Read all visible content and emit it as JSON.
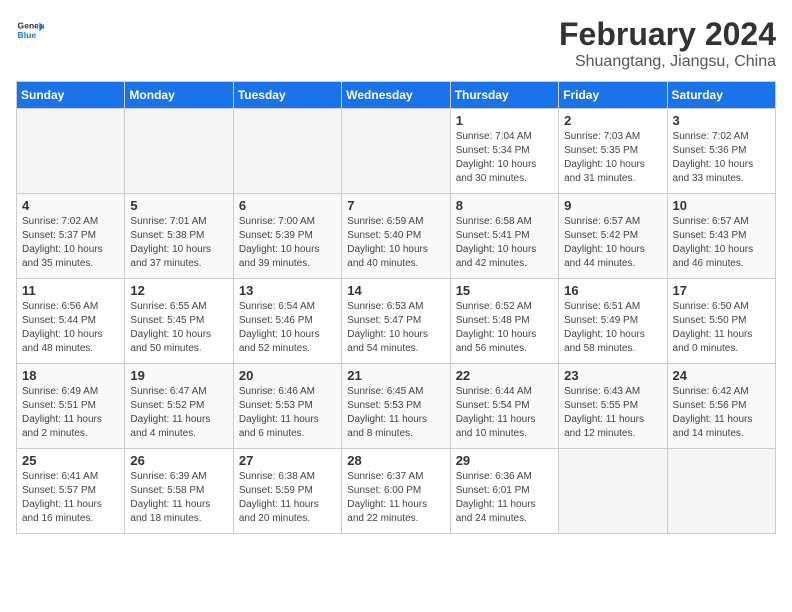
{
  "header": {
    "logo_general": "General",
    "logo_blue": "Blue",
    "month_year": "February 2024",
    "location": "Shuangtang, Jiangsu, China"
  },
  "days_of_week": [
    "Sunday",
    "Monday",
    "Tuesday",
    "Wednesday",
    "Thursday",
    "Friday",
    "Saturday"
  ],
  "weeks": [
    [
      {
        "num": "",
        "text": ""
      },
      {
        "num": "",
        "text": ""
      },
      {
        "num": "",
        "text": ""
      },
      {
        "num": "",
        "text": ""
      },
      {
        "num": "1",
        "text": "Sunrise: 7:04 AM\nSunset: 5:34 PM\nDaylight: 10 hours\nand 30 minutes."
      },
      {
        "num": "2",
        "text": "Sunrise: 7:03 AM\nSunset: 5:35 PM\nDaylight: 10 hours\nand 31 minutes."
      },
      {
        "num": "3",
        "text": "Sunrise: 7:02 AM\nSunset: 5:36 PM\nDaylight: 10 hours\nand 33 minutes."
      }
    ],
    [
      {
        "num": "4",
        "text": "Sunrise: 7:02 AM\nSunset: 5:37 PM\nDaylight: 10 hours\nand 35 minutes."
      },
      {
        "num": "5",
        "text": "Sunrise: 7:01 AM\nSunset: 5:38 PM\nDaylight: 10 hours\nand 37 minutes."
      },
      {
        "num": "6",
        "text": "Sunrise: 7:00 AM\nSunset: 5:39 PM\nDaylight: 10 hours\nand 39 minutes."
      },
      {
        "num": "7",
        "text": "Sunrise: 6:59 AM\nSunset: 5:40 PM\nDaylight: 10 hours\nand 40 minutes."
      },
      {
        "num": "8",
        "text": "Sunrise: 6:58 AM\nSunset: 5:41 PM\nDaylight: 10 hours\nand 42 minutes."
      },
      {
        "num": "9",
        "text": "Sunrise: 6:57 AM\nSunset: 5:42 PM\nDaylight: 10 hours\nand 44 minutes."
      },
      {
        "num": "10",
        "text": "Sunrise: 6:57 AM\nSunset: 5:43 PM\nDaylight: 10 hours\nand 46 minutes."
      }
    ],
    [
      {
        "num": "11",
        "text": "Sunrise: 6:56 AM\nSunset: 5:44 PM\nDaylight: 10 hours\nand 48 minutes."
      },
      {
        "num": "12",
        "text": "Sunrise: 6:55 AM\nSunset: 5:45 PM\nDaylight: 10 hours\nand 50 minutes."
      },
      {
        "num": "13",
        "text": "Sunrise: 6:54 AM\nSunset: 5:46 PM\nDaylight: 10 hours\nand 52 minutes."
      },
      {
        "num": "14",
        "text": "Sunrise: 6:53 AM\nSunset: 5:47 PM\nDaylight: 10 hours\nand 54 minutes."
      },
      {
        "num": "15",
        "text": "Sunrise: 6:52 AM\nSunset: 5:48 PM\nDaylight: 10 hours\nand 56 minutes."
      },
      {
        "num": "16",
        "text": "Sunrise: 6:51 AM\nSunset: 5:49 PM\nDaylight: 10 hours\nand 58 minutes."
      },
      {
        "num": "17",
        "text": "Sunrise: 6:50 AM\nSunset: 5:50 PM\nDaylight: 11 hours\nand 0 minutes."
      }
    ],
    [
      {
        "num": "18",
        "text": "Sunrise: 6:49 AM\nSunset: 5:51 PM\nDaylight: 11 hours\nand 2 minutes."
      },
      {
        "num": "19",
        "text": "Sunrise: 6:47 AM\nSunset: 5:52 PM\nDaylight: 11 hours\nand 4 minutes."
      },
      {
        "num": "20",
        "text": "Sunrise: 6:46 AM\nSunset: 5:53 PM\nDaylight: 11 hours\nand 6 minutes."
      },
      {
        "num": "21",
        "text": "Sunrise: 6:45 AM\nSunset: 5:53 PM\nDaylight: 11 hours\nand 8 minutes."
      },
      {
        "num": "22",
        "text": "Sunrise: 6:44 AM\nSunset: 5:54 PM\nDaylight: 11 hours\nand 10 minutes."
      },
      {
        "num": "23",
        "text": "Sunrise: 6:43 AM\nSunset: 5:55 PM\nDaylight: 11 hours\nand 12 minutes."
      },
      {
        "num": "24",
        "text": "Sunrise: 6:42 AM\nSunset: 5:56 PM\nDaylight: 11 hours\nand 14 minutes."
      }
    ],
    [
      {
        "num": "25",
        "text": "Sunrise: 6:41 AM\nSunset: 5:57 PM\nDaylight: 11 hours\nand 16 minutes."
      },
      {
        "num": "26",
        "text": "Sunrise: 6:39 AM\nSunset: 5:58 PM\nDaylight: 11 hours\nand 18 minutes."
      },
      {
        "num": "27",
        "text": "Sunrise: 6:38 AM\nSunset: 5:59 PM\nDaylight: 11 hours\nand 20 minutes."
      },
      {
        "num": "28",
        "text": "Sunrise: 6:37 AM\nSunset: 6:00 PM\nDaylight: 11 hours\nand 22 minutes."
      },
      {
        "num": "29",
        "text": "Sunrise: 6:36 AM\nSunset: 6:01 PM\nDaylight: 11 hours\nand 24 minutes."
      },
      {
        "num": "",
        "text": ""
      },
      {
        "num": "",
        "text": ""
      }
    ]
  ]
}
